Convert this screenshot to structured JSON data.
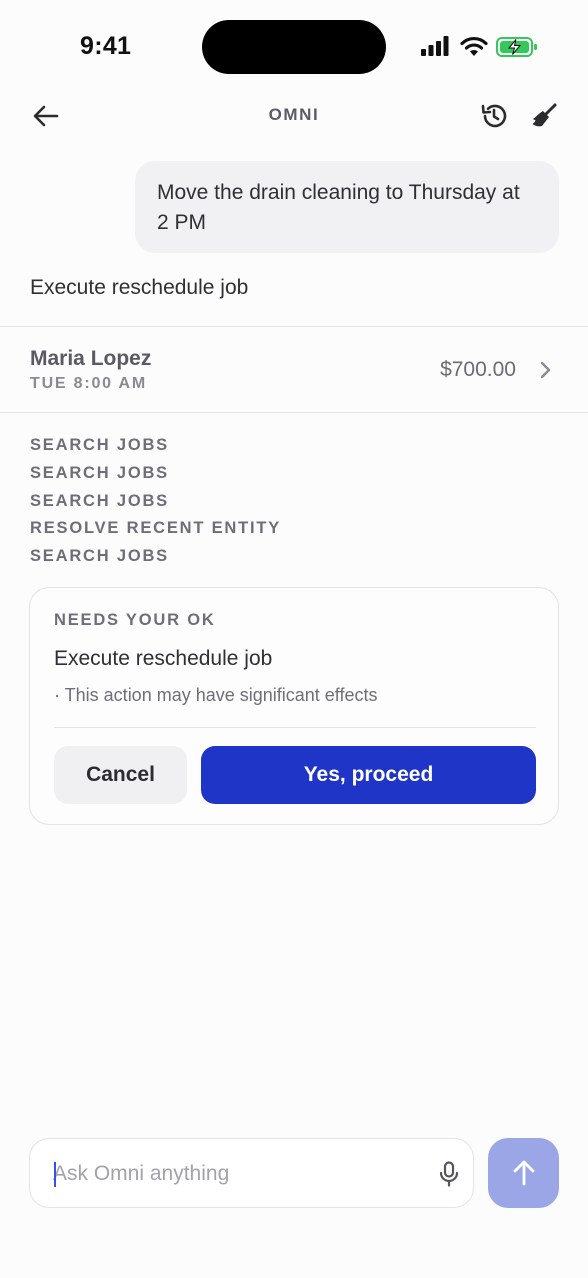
{
  "status_bar": {
    "time": "9:41",
    "icons": [
      "cellular-signal-icon",
      "wifi-icon",
      "battery-charging-icon"
    ],
    "battery_color": "#34c759"
  },
  "header": {
    "title": "OMNI",
    "back_icon": "arrow-left-icon",
    "history_icon": "history-icon",
    "clear_icon": "broom-icon"
  },
  "conversation": {
    "user_message": "Move the drain cleaning to Thursday at 2 PM",
    "assistant_message": "Execute reschedule job"
  },
  "job_card": {
    "customer": "Maria Lopez",
    "schedule": "TUE 8:00 AM",
    "amount": "$700.00",
    "chevron_icon": "chevron-right-icon"
  },
  "tool_steps": [
    "SEARCH JOBS",
    "SEARCH JOBS",
    "SEARCH JOBS",
    "RESOLVE RECENT ENTITY",
    "SEARCH JOBS"
  ],
  "confirmation": {
    "label": "NEEDS YOUR OK",
    "title": "Execute reschedule job",
    "note": "· This action may have significant effects",
    "cancel_label": "Cancel",
    "proceed_label": "Yes, proceed",
    "proceed_color": "#1f35c7"
  },
  "composer": {
    "value": "",
    "placeholder": "Ask Omni anything",
    "mic_icon": "microphone-icon",
    "send_icon": "arrow-up-icon",
    "send_color": "#9aa6e6"
  }
}
